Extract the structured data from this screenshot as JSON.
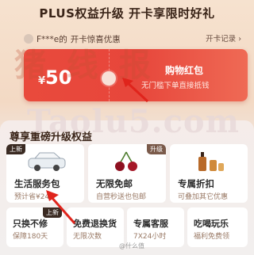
{
  "header": {
    "title": "PLUS权益升级 开卡享限时好礼"
  },
  "notice": {
    "user": "F***e的",
    "message": "开卡惊喜优惠",
    "record_label": "开卡记录 ›"
  },
  "watermark": {
    "line1": "猪 线 报",
    "line2": "Taolu5.com"
  },
  "coupon": {
    "currency": "¥",
    "amount": "50",
    "title": "购物红包",
    "subtitle": "无门槛下单直接抵钱"
  },
  "benefits": {
    "title": "尊享重磅升级权益",
    "cards": [
      {
        "tag": "上新",
        "title": "生活服务包",
        "subtitle": "预计省¥240"
      },
      {
        "tag": "升级",
        "title": "无限免邮",
        "subtitle": "自营秒送也包邮"
      },
      {
        "tag": "",
        "title": "专属折扣",
        "subtitle": "可叠加其它优惠"
      }
    ],
    "mini_cards": [
      {
        "tag": "上新",
        "title": "只换不修",
        "subtitle": "保障180天"
      },
      {
        "tag": "",
        "title": "免费退换货",
        "subtitle": "无限次数"
      },
      {
        "tag": "",
        "title": "专属客服",
        "subtitle": "7X24小时"
      },
      {
        "tag": "",
        "title": "吃喝玩乐",
        "subtitle": "福利免费领"
      }
    ]
  },
  "footer_watermark": "@什么值"
}
